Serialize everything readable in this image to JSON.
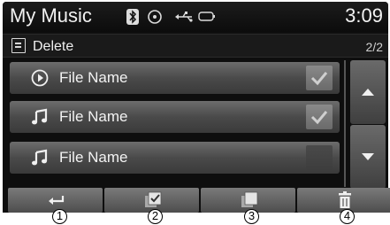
{
  "header": {
    "title": "My Music",
    "clock": "3:09",
    "status_icons": [
      "bluetooth-icon",
      "disc-icon",
      "usb-icon",
      "battery-icon"
    ]
  },
  "subheader": {
    "label": "Delete",
    "page": "2/2"
  },
  "list": [
    {
      "name": "File Name",
      "icon": "play-icon",
      "checked": true
    },
    {
      "name": "File Name",
      "icon": "music-note-icon",
      "checked": true
    },
    {
      "name": "File Name",
      "icon": "music-note-icon",
      "checked": false
    }
  ],
  "bottom_buttons": [
    {
      "icon": "back-icon",
      "number": "1"
    },
    {
      "icon": "select-all-icon",
      "number": "2"
    },
    {
      "icon": "deselect-all-icon",
      "number": "3"
    },
    {
      "icon": "trash-icon",
      "number": "4"
    }
  ]
}
